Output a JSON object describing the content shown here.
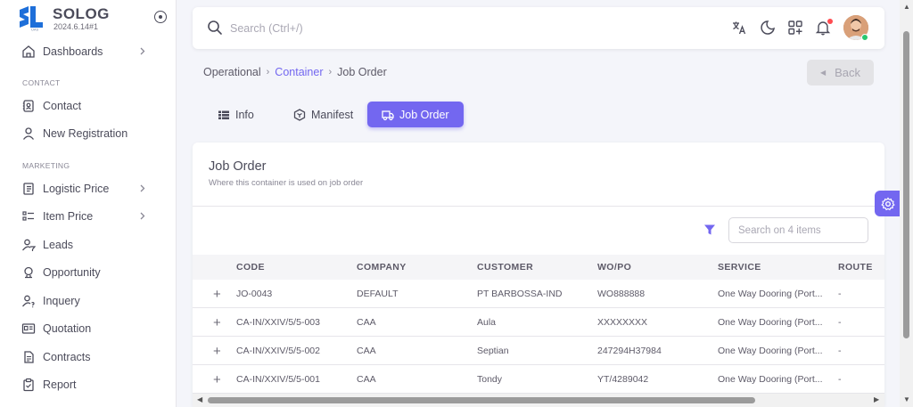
{
  "brand": {
    "name": "SOLOG",
    "version": "2024.6.14#1"
  },
  "sidebar": {
    "sections": {
      "contact": "CONTACT",
      "marketing": "MARKETING"
    },
    "items": [
      {
        "label": "Dashboards",
        "icon": "home-icon"
      },
      {
        "label": "Contact",
        "icon": "contact-book-icon"
      },
      {
        "label": "New Registration",
        "icon": "user-icon"
      },
      {
        "label": "Logistic Price",
        "icon": "notebook-icon"
      },
      {
        "label": "Item Price",
        "icon": "list-icon"
      },
      {
        "label": "Leads",
        "icon": "user-filter-icon"
      },
      {
        "label": "Opportunity",
        "icon": "opportunity-icon"
      },
      {
        "label": "Inquery",
        "icon": "user-question-icon"
      },
      {
        "label": "Quotation",
        "icon": "id-card-icon"
      },
      {
        "label": "Contracts",
        "icon": "contract-icon"
      },
      {
        "label": "Report",
        "icon": "clipboard-icon"
      }
    ]
  },
  "topbar": {
    "search_placeholder": "Search (Ctrl+/)"
  },
  "breadcrumb": {
    "items": [
      "Operational",
      "Container",
      "Job Order"
    ]
  },
  "back_label": "Back",
  "tabs": [
    {
      "label": "Info",
      "icon": "list-icon"
    },
    {
      "label": "Manifest",
      "icon": "box-icon"
    },
    {
      "label": "Job Order",
      "icon": "truck-icon",
      "active": true
    }
  ],
  "card": {
    "title": "Job Order",
    "subtitle": "Where this container is used on job order",
    "search_placeholder": "Search on 4 items"
  },
  "table": {
    "columns": [
      "CODE",
      "COMPANY",
      "CUSTOMER",
      "WO/PO",
      "SERVICE",
      "ROUTE"
    ],
    "rows": [
      [
        "JO-0043",
        "DEFAULT",
        "PT BARBOSSA-IND",
        "WO888888",
        "One Way Dooring (Port...",
        "-"
      ],
      [
        "CA-IN/XXIV/5/5-003",
        "CAA",
        "Aula",
        "XXXXXXXX",
        "One Way Dooring (Port...",
        "-"
      ],
      [
        "CA-IN/XXIV/5/5-002",
        "CAA",
        "Septian",
        "247294H37984",
        "One Way Dooring (Port...",
        "-"
      ],
      [
        "CA-IN/XXIV/5/5-001",
        "CAA",
        "Tondy",
        "YT/4289042",
        "One Way Dooring (Port...",
        "-"
      ]
    ]
  },
  "colors": {
    "primary": "#7367f0",
    "notification": "#ff4c51",
    "online": "#28c76f"
  }
}
